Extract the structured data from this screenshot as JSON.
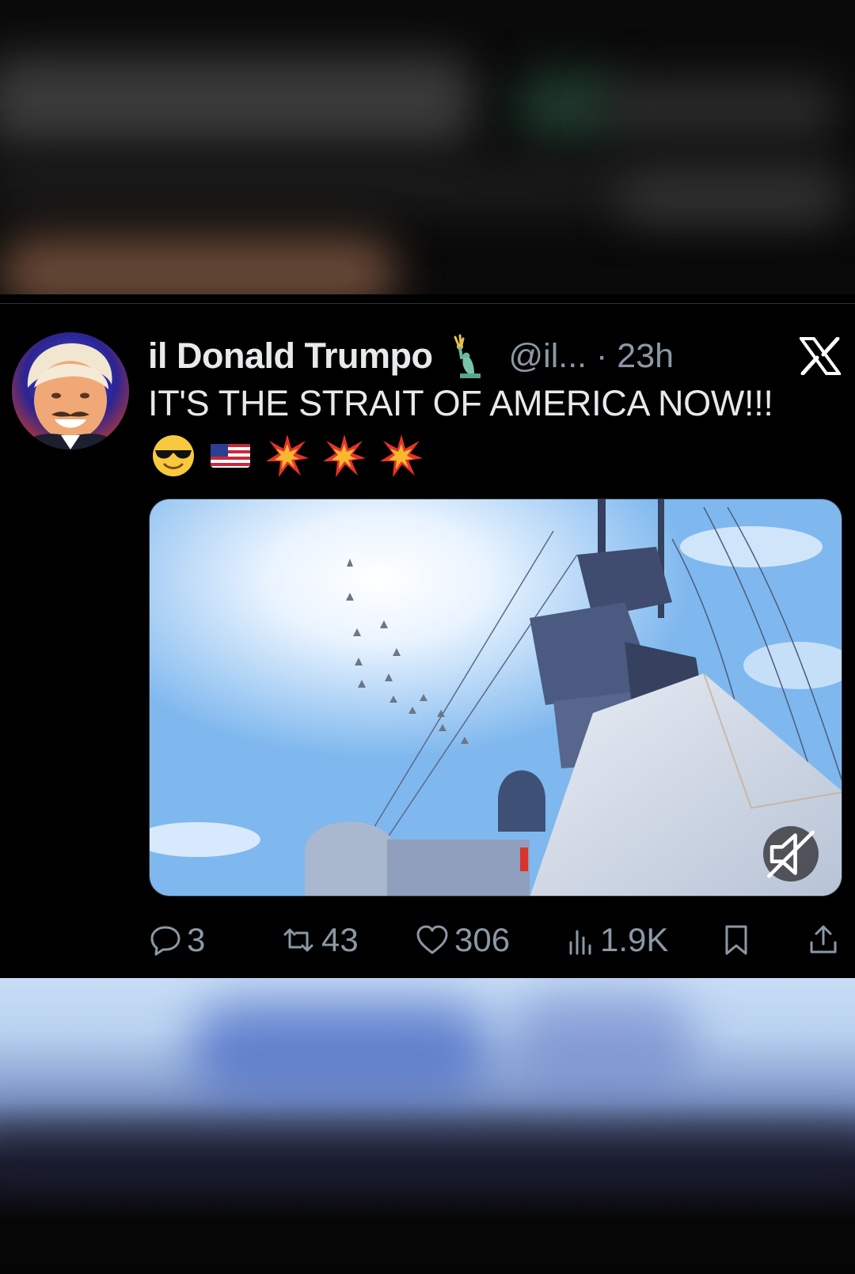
{
  "tweet": {
    "display_name": "il Donald Trumpo",
    "badge_icon": "statue-of-liberty-icon",
    "handle_time": "@il... · 23h",
    "text": "IT'S THE STRAIT OF AMERICA NOW!!!",
    "emojis": [
      "smiling-face-with-sunglasses-icon",
      "us-flag-icon",
      "collision-icon",
      "collision-icon",
      "collision-icon"
    ],
    "media": {
      "type": "video",
      "muted": true
    }
  },
  "actions": {
    "replies": "3",
    "reposts": "43",
    "likes": "306",
    "views": "1.9K"
  },
  "colors": {
    "background": "#000000",
    "text": "#e7e9ea",
    "secondary_text": "#8b98a5",
    "divider": "#2f3336"
  }
}
